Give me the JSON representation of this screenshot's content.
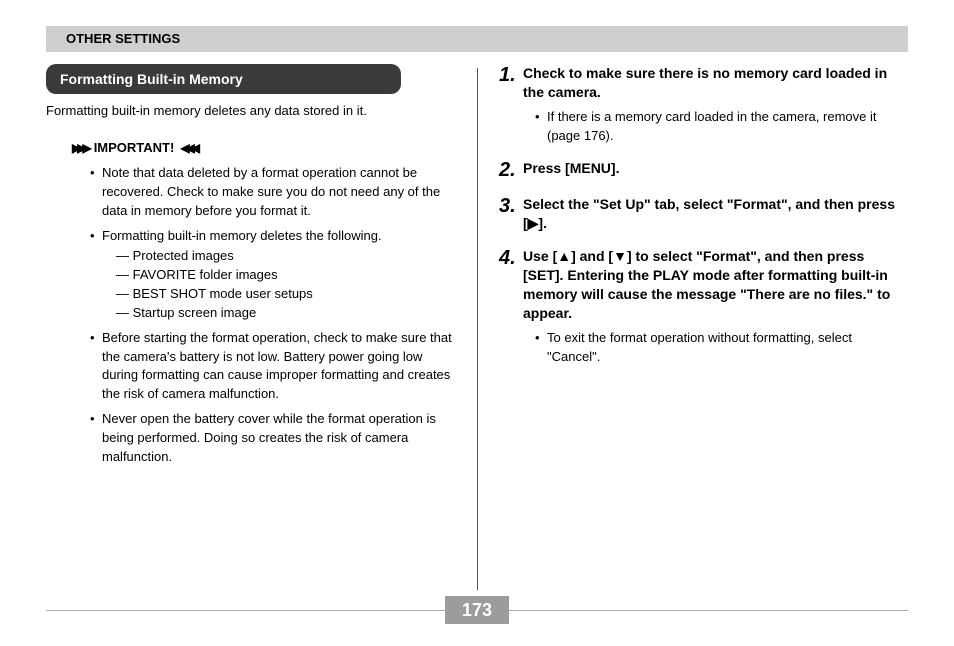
{
  "header": "OTHER SETTINGS",
  "section_title": "Formatting Built-in Memory",
  "intro": "Formatting built-in memory deletes any data stored in it.",
  "important_label": "IMPORTANT!",
  "important": {
    "b1": "Note that data deleted by a format operation cannot be recovered. Check to make sure you do not need any of the data in memory before you format it.",
    "b2": "Formatting built-in memory deletes the following.",
    "d1": "Protected images",
    "d2": "FAVORITE folder images",
    "d3": "BEST SHOT mode user setups",
    "d4": "Startup screen image",
    "b3": "Before starting the format operation, check to make sure that the camera's battery is not low. Battery power going low during formatting can cause improper formatting and creates the risk of camera malfunction.",
    "b4": "Never open the battery cover while the format operation is being performed. Doing so creates the risk of camera malfunction."
  },
  "steps": {
    "s1": {
      "num": "1.",
      "title": "Check to make sure there is no memory card loaded in the camera.",
      "sub": "If there is a memory card loaded in the camera, remove it (page 176)."
    },
    "s2": {
      "num": "2.",
      "title": "Press [MENU]."
    },
    "s3": {
      "num": "3.",
      "title": "Select the \"Set Up\" tab, select \"Format\", and then press [▶]."
    },
    "s4": {
      "num": "4.",
      "title": "Use [▲] and [▼] to select \"Format\", and then press [SET]. Entering the PLAY mode after formatting built-in memory will cause the message \"There are no files.\" to appear.",
      "sub": "To exit the format operation without formatting, select \"Cancel\"."
    }
  },
  "page_number": "173"
}
